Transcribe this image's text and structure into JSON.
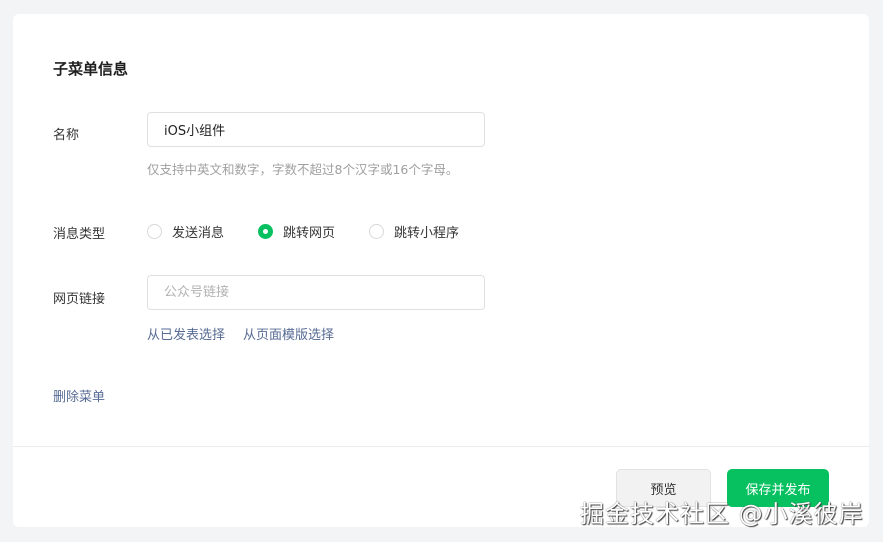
{
  "section_title": "子菜单信息",
  "name": {
    "label": "名称",
    "value": "iOS小组件",
    "hint": "仅支持中英文和数字，字数不超过8个汉字或16个字母。"
  },
  "message_type": {
    "label": "消息类型",
    "options": [
      "发送消息",
      "跳转网页",
      "跳转小程序"
    ],
    "selected": "跳转网页"
  },
  "page_link": {
    "label": "网页链接",
    "placeholder": "公众号链接",
    "value": "",
    "links": [
      "从已发表选择",
      "从页面模版选择"
    ]
  },
  "delete_label": "删除菜单",
  "buttons": {
    "preview": "预览",
    "save": "保存并发布"
  },
  "watermark": "掘金技术社区 @小溪彼岸",
  "colors": {
    "accent": "#07c160",
    "link": "#576b95"
  }
}
